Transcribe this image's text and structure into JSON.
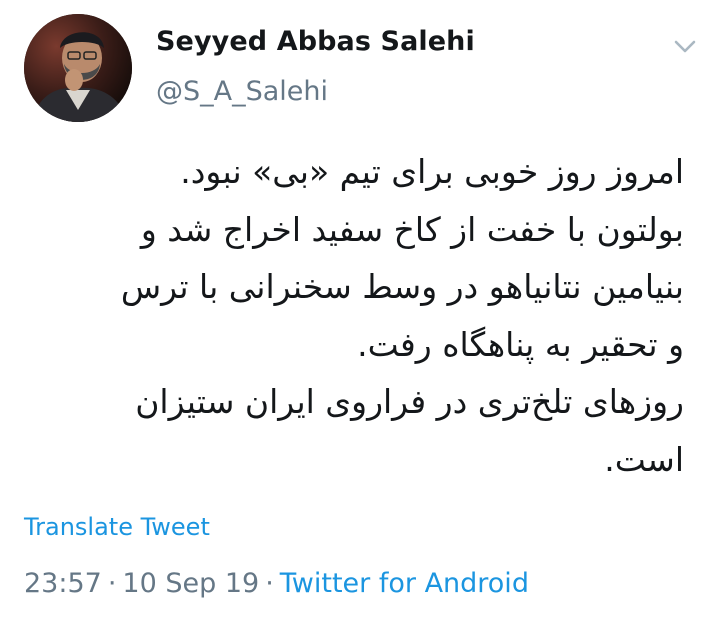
{
  "author": {
    "name": "Seyyed Abbas Salehi",
    "handle": "@S_A_Salehi"
  },
  "tweet": {
    "lines": [
      "امروز روز خوبی برای تیم «بی» نبود.",
      "بولتون با خفت از کاخ سفید اخراج شد و",
      "بنیامین نتانیاهو در وسط سخنرانی با ترس",
      "و تحقیر به پناهگاه رفت.",
      "روزهای تلخ‌تری در فراروی ایران ستیزان",
      "است."
    ]
  },
  "actions": {
    "translate_label": "Translate Tweet"
  },
  "meta": {
    "time": "23:57",
    "separator": "·",
    "date": "10 Sep 19",
    "source": "Twitter for Android"
  },
  "icons": {
    "menu": "chevron-down-icon"
  },
  "colors": {
    "name_text": "#14171a",
    "secondary_text": "#657786",
    "link": "#1b95e0"
  }
}
